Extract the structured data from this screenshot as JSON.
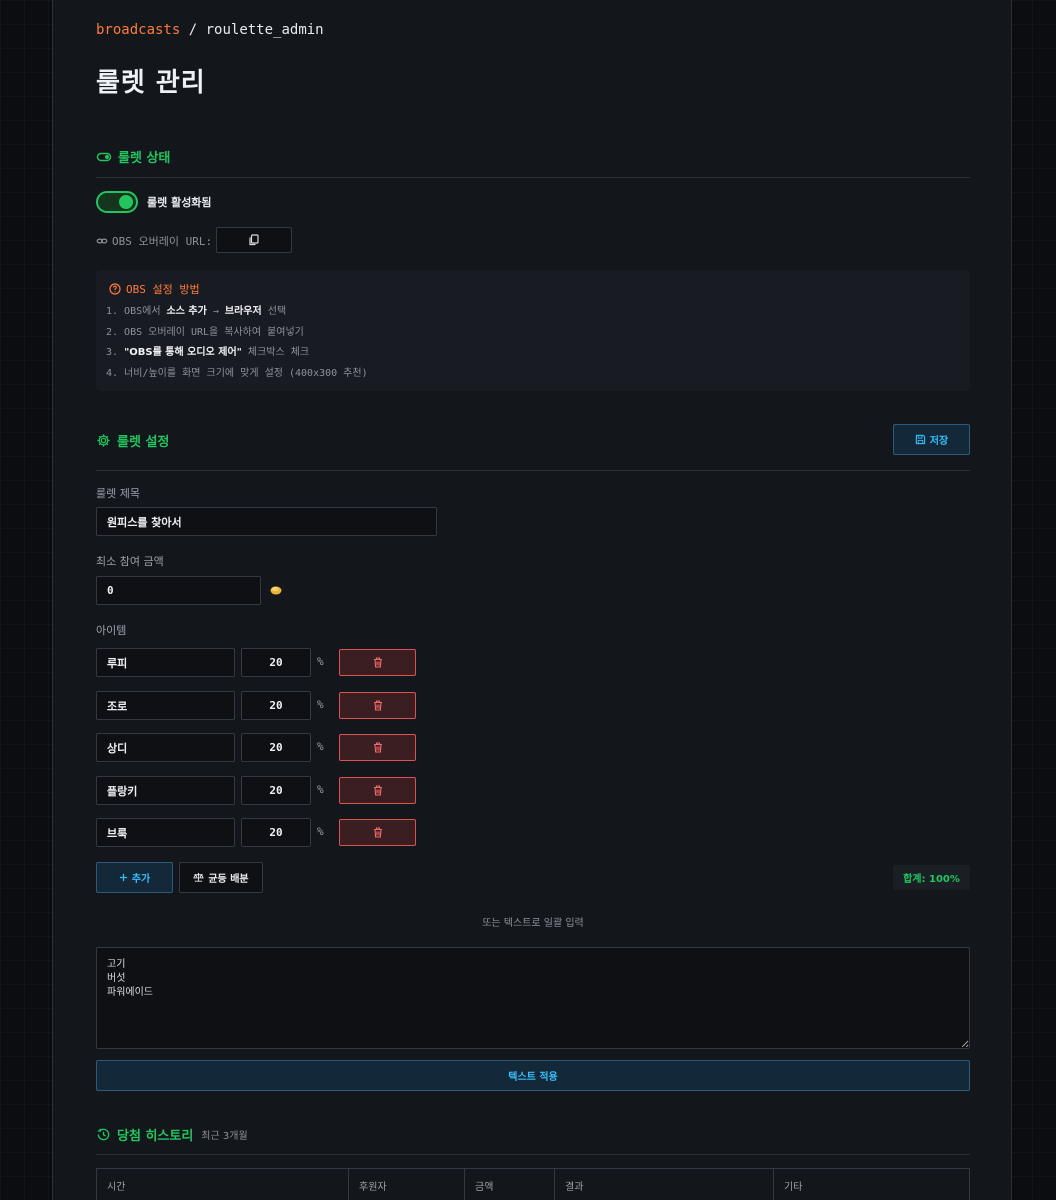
{
  "breadcrumb": {
    "parent": "broadcasts",
    "separator": "/",
    "current": "roulette_admin"
  },
  "page_title": "룰렛 관리",
  "status_section": {
    "title": "룰렛 상태",
    "toggle_label": "룰렛 활성화됨",
    "toggle_on": true,
    "url_label": "OBS 오버레이 URL:",
    "url_value": ""
  },
  "guide": {
    "title": "OBS 설정 방법",
    "step1": {
      "a": "1. OBS에서 ",
      "b": "소스 추가",
      "c": " → ",
      "d": "브라우저",
      "e": " 선택"
    },
    "step2": "2. OBS 오버레이 URL을 복사하여 붙여넣기",
    "step3": {
      "a": "3. ",
      "b": "\"OBS를 통해 오디오 제어\"",
      "c": " 체크박스 체크"
    },
    "step4": "4. 너비/높이를 화면 크기에 맞게 설정 (400x300 추천)"
  },
  "settings_section": {
    "title": "룰렛 설정",
    "save_label": "저장",
    "title_field_label": "룰렛 제목",
    "title_value": "원피스를 찾아서",
    "min_amount_label": "최소 참여 금액",
    "min_amount_value": "0",
    "items_label": "아이템",
    "items": [
      {
        "name": "루피",
        "percent": "20"
      },
      {
        "name": "조로",
        "percent": "20"
      },
      {
        "name": "상디",
        "percent": "20"
      },
      {
        "name": "플랑키",
        "percent": "20"
      },
      {
        "name": "브룩",
        "percent": "20"
      }
    ],
    "percent_sign": "%",
    "add_label": "추가",
    "even_label": "균등 배분",
    "total_label": "합계: 100%",
    "bulk_label": "또는 텍스트로 일괄 입력",
    "bulk_text": "고기\n버섯\n파워에이드",
    "apply_label": "텍스트 적용"
  },
  "history_section": {
    "title": "당첨 히스토리",
    "subtitle": "최근 3개월",
    "columns": [
      "시간",
      "후원자",
      "금액",
      "결과",
      "기타"
    ]
  },
  "colors": {
    "accent_orange": "#ff7a3d",
    "accent_green": "#22c55e",
    "accent_blue": "#38bdf8",
    "danger_red": "#d9534f"
  }
}
